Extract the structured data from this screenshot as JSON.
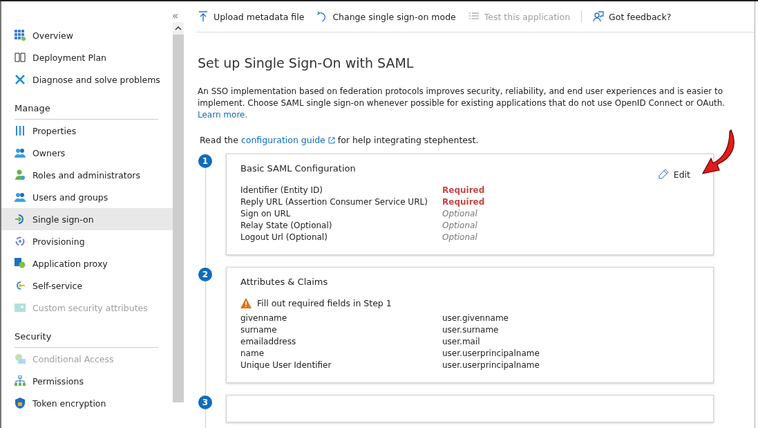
{
  "sidebar": {
    "collapse": "«",
    "sections": [
      {
        "items": [
          {
            "label": "Overview",
            "selected": false,
            "disabled": false
          },
          {
            "label": "Deployment Plan",
            "selected": false,
            "disabled": false
          },
          {
            "label": "Diagnose and solve problems",
            "selected": false,
            "disabled": false
          }
        ]
      },
      {
        "heading": "Manage",
        "items": [
          {
            "label": "Properties",
            "selected": false,
            "disabled": false
          },
          {
            "label": "Owners",
            "selected": false,
            "disabled": false
          },
          {
            "label": "Roles and administrators",
            "selected": false,
            "disabled": false
          },
          {
            "label": "Users and groups",
            "selected": false,
            "disabled": false
          },
          {
            "label": "Single sign-on",
            "selected": true,
            "disabled": false
          },
          {
            "label": "Provisioning",
            "selected": false,
            "disabled": false
          },
          {
            "label": "Application proxy",
            "selected": false,
            "disabled": false
          },
          {
            "label": "Self-service",
            "selected": false,
            "disabled": false
          },
          {
            "label": "Custom security attributes",
            "selected": false,
            "disabled": true
          }
        ]
      },
      {
        "heading": "Security",
        "items": [
          {
            "label": "Conditional Access",
            "selected": false,
            "disabled": true
          },
          {
            "label": "Permissions",
            "selected": false,
            "disabled": false
          },
          {
            "label": "Token encryption",
            "selected": false,
            "disabled": false
          }
        ]
      }
    ]
  },
  "toolbar": [
    {
      "label": "Upload metadata file",
      "disabled": false
    },
    {
      "label": "Change single sign-on mode",
      "disabled": false
    },
    {
      "label": "Test this application",
      "disabled": true
    },
    {
      "label": "Got feedback?",
      "disabled": false
    }
  ],
  "title": "Set up Single Sign-On with SAML",
  "intro": "An SSO implementation based on federation protocols improves security, reliability, and end user experiences and is easier to implement. Choose SAML single sign-on whenever possible for existing applications that do not use OpenID Connect or OAuth.",
  "intro_link": "Learn more.",
  "guide": {
    "before": "Read the",
    "link": "configuration guide",
    "after": "for help integrating stephentest."
  },
  "steps": [
    {
      "number": "1",
      "title": "Basic SAML Configuration",
      "edit": "Edit",
      "rows": [
        {
          "name": "Identifier (Entity ID)",
          "value": "Required",
          "kind": "required"
        },
        {
          "name": "Reply URL (Assertion Consumer Service URL)",
          "value": "Required",
          "kind": "required"
        },
        {
          "name": "Sign on URL",
          "value": "Optional",
          "kind": "optional"
        },
        {
          "name": "Relay State (Optional)",
          "value": "Optional",
          "kind": "optional"
        },
        {
          "name": "Logout Url (Optional)",
          "value": "Optional",
          "kind": "optional"
        }
      ]
    },
    {
      "number": "2",
      "title": "Attributes & Claims",
      "warning": "Fill out required fields in Step 1",
      "rows": [
        {
          "name": "givenname",
          "value": "user.givenname",
          "kind": "plain"
        },
        {
          "name": "surname",
          "value": "user.surname",
          "kind": "plain"
        },
        {
          "name": "emailaddress",
          "value": "user.mail",
          "kind": "plain"
        },
        {
          "name": "name",
          "value": "user.userprincipalname",
          "kind": "plain"
        },
        {
          "name": "Unique User Identifier",
          "value": "user.userprincipalname",
          "kind": "plain"
        }
      ]
    },
    {
      "number": "3"
    }
  ]
}
